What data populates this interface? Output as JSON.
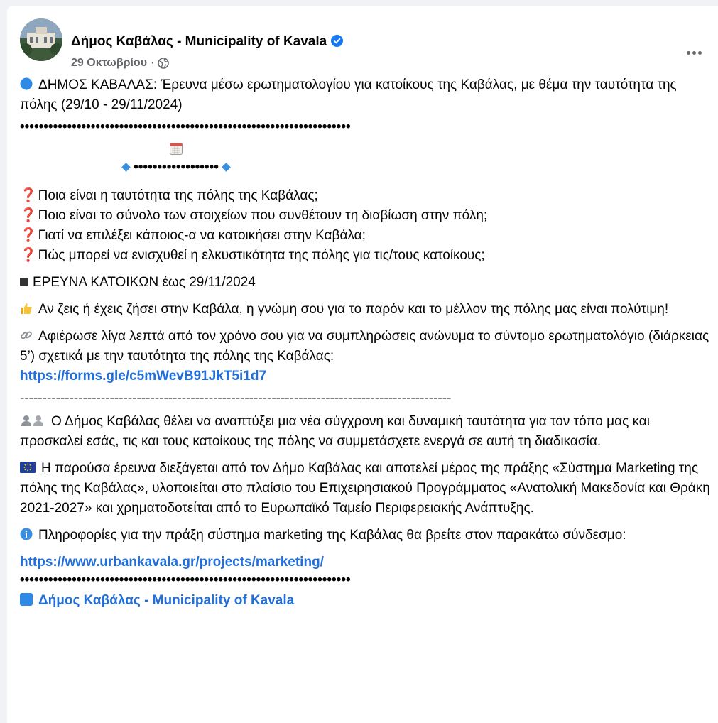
{
  "post": {
    "author": "Δήμος Καβάλας - Municipality of Kavala",
    "date": "29 Οκτωβρίου",
    "dot": "·",
    "intro_line": "ΔΗΜΟΣ ΚΑΒΑΛΑΣ: Έρευνα μέσω ερωτηματολογίου για κατοίκους της Καβάλας, με θέμα την ταυτότητα της πόλης (29/10 - 29/11/2024)",
    "dotted_separator": "••••••••••••••••••••••••••••••••••••••••••••••••••••••••••••••••••••••",
    "diamond_dots": "••••••••••••••••••",
    "questions": [
      "Ποια είναι η ταυτότητα της πόλης της Καβάλας;",
      "Ποιο είναι το σύνολο των στοιχείων που συνθέτουν τη διαβίωση στην πόλη;",
      "Γιατί να επιλέξει κάποιος-α να κατοικήσει στην Καβάλα;",
      "Πώς μπορεί να ενισχυθεί η ελκυστικότητα της πόλης για τις/τους κατοίκους;"
    ],
    "survey_title": "ΕΡΕΥΝΑ ΚΑΤΟΙΚΩΝ έως 29/11/2024",
    "opinion_text": "Αν ζεις ή έχεις ζήσει στην Καβάλα, η γνώμη σου για το παρόν και το μέλλον της πόλης μας είναι πολύτιμη!",
    "form_text": "Αφιέρωσε λίγα λεπτά από τον χρόνο σου για να συμπληρώσεις ανώνυμα το σύντομο ερωτηματολόγιο (διάρκειας 5’) σχετικά με την ταυτότητα της πόλης της Καβάλας:",
    "form_link": "https://forms.gle/c5mWevB91JkT5i1d7",
    "dashed_separator": "------------------------------------------------------------------------------------------------",
    "identity_text": "Ο Δήμος Καβάλας θέλει να αναπτύξει μια νέα σύγχρονη και δυναμική ταυτότητα για τον τόπο μας και προσκαλεί εσάς, τις και τους κατοίκους της πόλης να συμμετάσχετε ενεργά σε αυτή τη διαδικασία.",
    "eu_text": "Η παρούσα έρευνα διεξάγεται από τον Δήμο Καβάλας και αποτελεί μέρος της πράξης «Σύστημα Marketing της πόλης της Καβάλας», υλοποιείται στο πλαίσιο του Επιχειρησιακού Προγράμματος «Ανατολική Μακεδονία και Θράκη 2021-2027» και χρηματοδοτείται από το Ευρωπαϊκό Ταμείο Περιφερειακής Ανάπτυξης.",
    "info_text": "Πληροφορίες για την πράξη σύστημα marketing της Καβάλας θα βρείτε στον παρακάτω σύνδεσμο:",
    "info_link": "https://www.urbankavala.gr/projects/marketing/",
    "signature": "Δήμος Καβάλας - Municipality of Kavala"
  },
  "colors": {
    "link": "#216fdb",
    "meta": "#65676b",
    "verified": "#1877f2"
  },
  "icons": [
    "verified-badge-icon",
    "globe-icon",
    "more-options-icon",
    "blue-circle-icon",
    "calendar-icon",
    "question-mark-icon",
    "black-square-icon",
    "thumbs-up-icon",
    "link-icon",
    "people-icon",
    "eu-flag-icon",
    "info-icon",
    "blue-square-icon"
  ]
}
